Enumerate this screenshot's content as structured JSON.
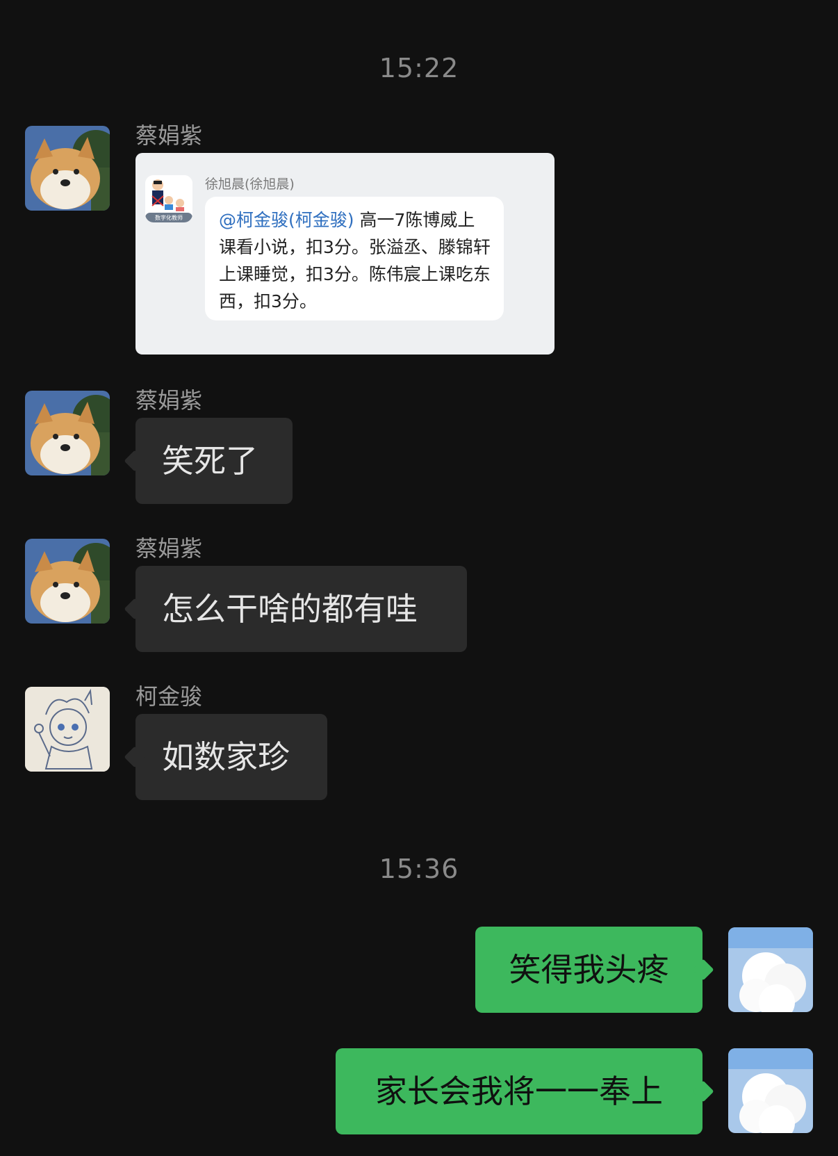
{
  "chat": {
    "timestamps": [
      "15:22",
      "15:36"
    ],
    "messages": [
      {
        "sender": "蔡娟紫",
        "type": "image",
        "quoted": {
          "name": "徐旭晨(徐旭晨)",
          "mention": "@柯金骏(柯金骏)",
          "text": " 高一7陈博威上课看小说，扣3分。张溢丞、滕锦轩上课睡觉，扣3分。陈伟宸上课吃东西，扣3分。",
          "avatar_badge": "数字化教师"
        }
      },
      {
        "sender": "蔡娟紫",
        "type": "text",
        "text": "笑死了"
      },
      {
        "sender": "蔡娟紫",
        "type": "text",
        "text": "怎么干啥的都有哇"
      },
      {
        "sender": "柯金骏",
        "type": "text",
        "text": "如数家珍"
      },
      {
        "sender": "me",
        "type": "text",
        "text": "笑得我头疼"
      },
      {
        "sender": "me",
        "type": "text",
        "text": "家长会我将一一奉上"
      }
    ]
  },
  "colors": {
    "background": "#111111",
    "incoming_bubble": "#2b2b2b",
    "outgoing_bubble": "#3db85d",
    "mention": "#2f6fbf"
  },
  "icons": {
    "avatar_dog": "shiba-dog-avatar",
    "avatar_sketch": "sketch-character-avatar",
    "avatar_me": "sheep-avatar"
  }
}
